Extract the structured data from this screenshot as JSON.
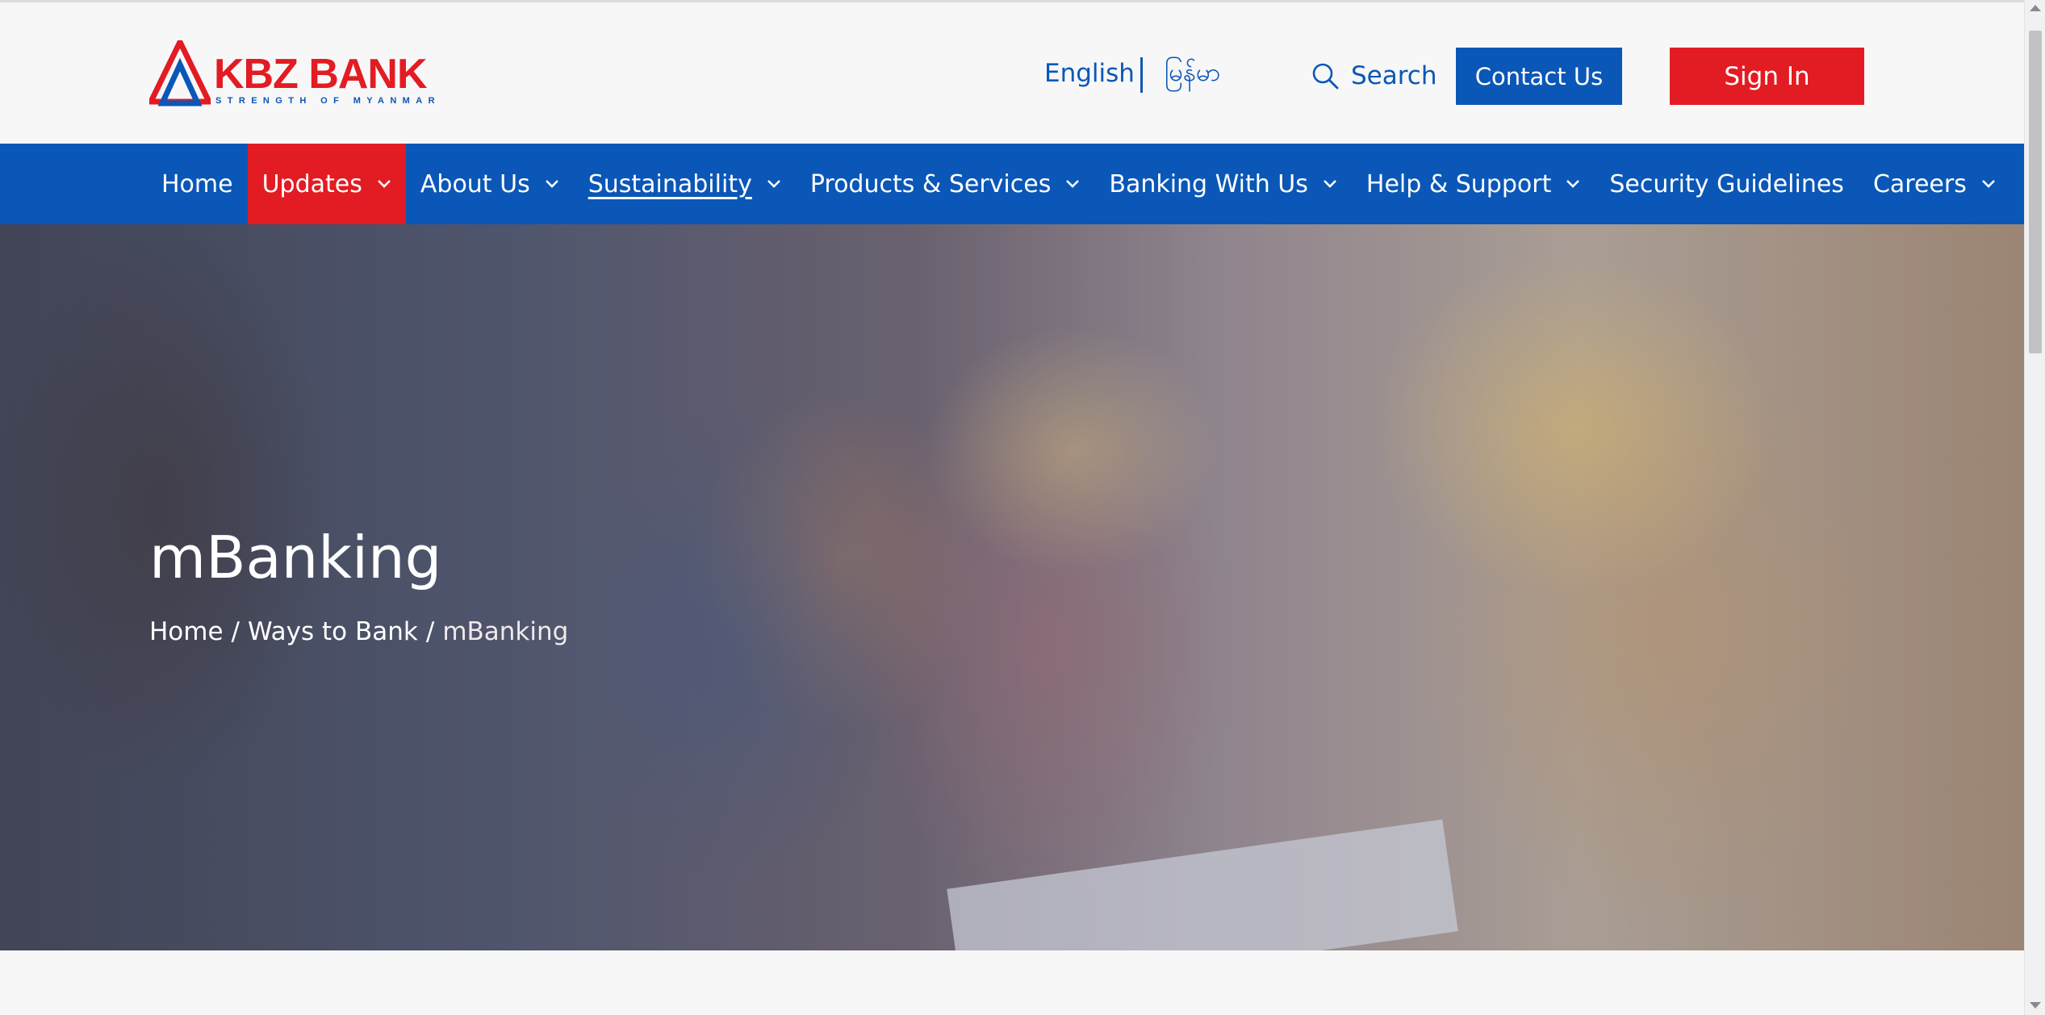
{
  "brand": {
    "name": "KBZ BANK",
    "tagline": "STRENGTH OF MYANMAR",
    "colors": {
      "red": "#e31b23",
      "blue": "#0a57b7"
    }
  },
  "header": {
    "lang_english": "English",
    "lang_myanmar": "မြန်မာ",
    "search_label": "Search",
    "contact_label": "Contact Us",
    "signin_label": "Sign In"
  },
  "nav": {
    "items": [
      {
        "label": "Home",
        "has_dropdown": false,
        "active": false
      },
      {
        "label": "Updates",
        "has_dropdown": true,
        "active": true
      },
      {
        "label": "About Us",
        "has_dropdown": true,
        "active": false
      },
      {
        "label": "Sustainability",
        "has_dropdown": true,
        "active": false,
        "underlined": true
      },
      {
        "label": "Products & Services",
        "has_dropdown": true,
        "active": false
      },
      {
        "label": "Banking With Us",
        "has_dropdown": true,
        "active": false
      },
      {
        "label": "Help & Support",
        "has_dropdown": true,
        "active": false
      },
      {
        "label": "Security Guidelines",
        "has_dropdown": false,
        "active": false
      },
      {
        "label": "Careers",
        "has_dropdown": true,
        "active": false
      }
    ]
  },
  "hero": {
    "title": "mBanking",
    "breadcrumb": {
      "home": "Home",
      "section": "Ways to Bank",
      "current": "mBanking",
      "separator": "/"
    }
  },
  "icons": {
    "search": "search-icon",
    "chevron": "chevron-down-icon",
    "logo": "kbz-logo-icon"
  }
}
